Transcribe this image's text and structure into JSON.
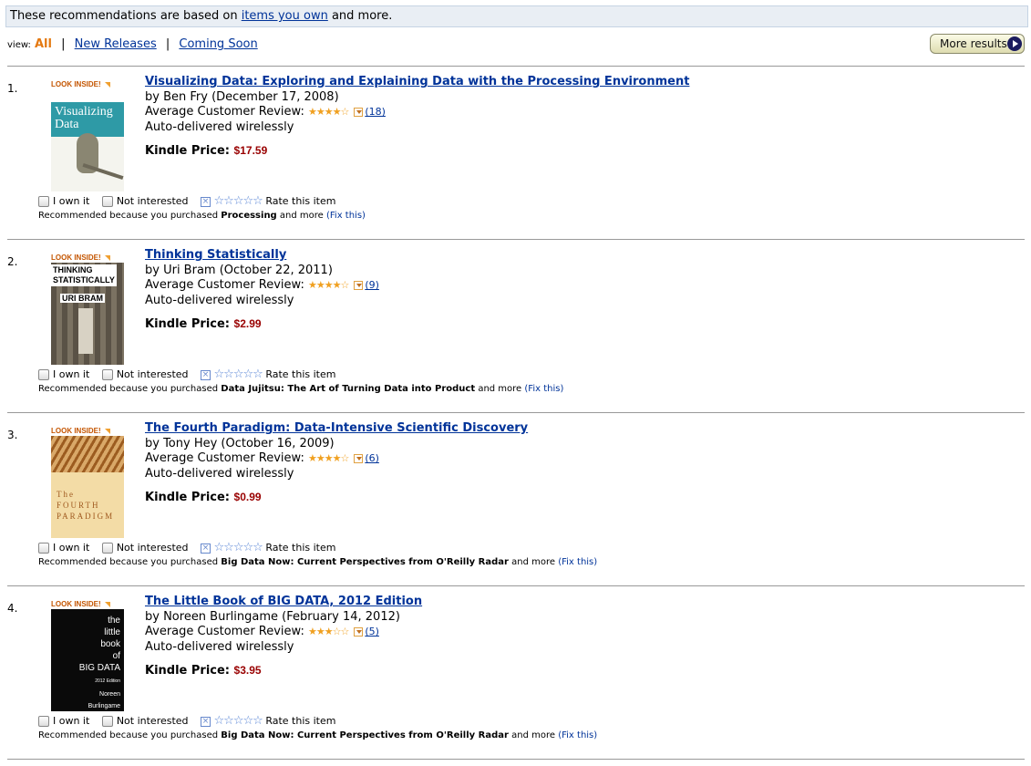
{
  "banner": {
    "prefix": "These recommendations are based on",
    "link": "items you own",
    "suffix": "and more."
  },
  "view": {
    "label": "view:",
    "all": "All",
    "new_releases": "New Releases",
    "coming_soon": "Coming Soon",
    "separator": "|"
  },
  "more_results": "More results",
  "common": {
    "by": "by",
    "review_label": "Average Customer Review:",
    "auto_delivered": "Auto-delivered wirelessly",
    "price_label": "Kindle Price:",
    "i_own_it": "I own it",
    "not_interested": "Not interested",
    "rate_this": "Rate this item",
    "because_prefix": "Recommended because you purchased",
    "because_and_more": "and more",
    "fix_this": "(Fix this)",
    "look_inside": "LOOK INSIDE!",
    "empty_stars": "☆☆☆☆☆"
  },
  "items": [
    {
      "rank": "1.",
      "title": "Visualizing Data: Exploring and Explaining Data with the Processing Environment",
      "author_date": "by Ben Fry (December 17, 2008)",
      "stars": "★★★★☆",
      "rating": 4,
      "review_count": "(18)",
      "price": "$17.59",
      "purchased": "Processing",
      "cover_text": "Visualizing Data",
      "cover_color": "#2e9aa6"
    },
    {
      "rank": "2.",
      "title": "Thinking Statistically",
      "author_date": "by Uri Bram (October 22, 2011)",
      "stars": "★★★★☆",
      "rating": 4.5,
      "review_count": "(9)",
      "price": "$2.99",
      "purchased": "Data Jujitsu: The Art of Turning Data into Product",
      "cover_text": "THINKING STATISTICALLY URI BRAM",
      "cover_color": "#6b6254"
    },
    {
      "rank": "3.",
      "title": "The Fourth Paradigm: Data-Intensive Scientific Discovery",
      "author_date": "by Tony Hey (October 16, 2009)",
      "stars": "★★★★☆",
      "rating": 4,
      "review_count": "(6)",
      "price": "$0.99",
      "purchased": "Big Data Now: Current Perspectives from O'Reilly Radar",
      "cover_text": "The FOURTH PARADIGM",
      "cover_color": "#f1d49a"
    },
    {
      "rank": "4.",
      "title": "The Little Book of BIG DATA, 2012 Edition",
      "author_date": "by Noreen Burlingame (February 14, 2012)",
      "stars": "★★★☆☆",
      "rating": 3.5,
      "review_count": "(5)",
      "price": "$3.95",
      "purchased": "Big Data Now: Current Perspectives from O'Reilly Radar",
      "cover_text": "the little book of BIG DATA 2012 Edition Noreen Burlingame",
      "cover_color": "#0a0a0a"
    }
  ]
}
